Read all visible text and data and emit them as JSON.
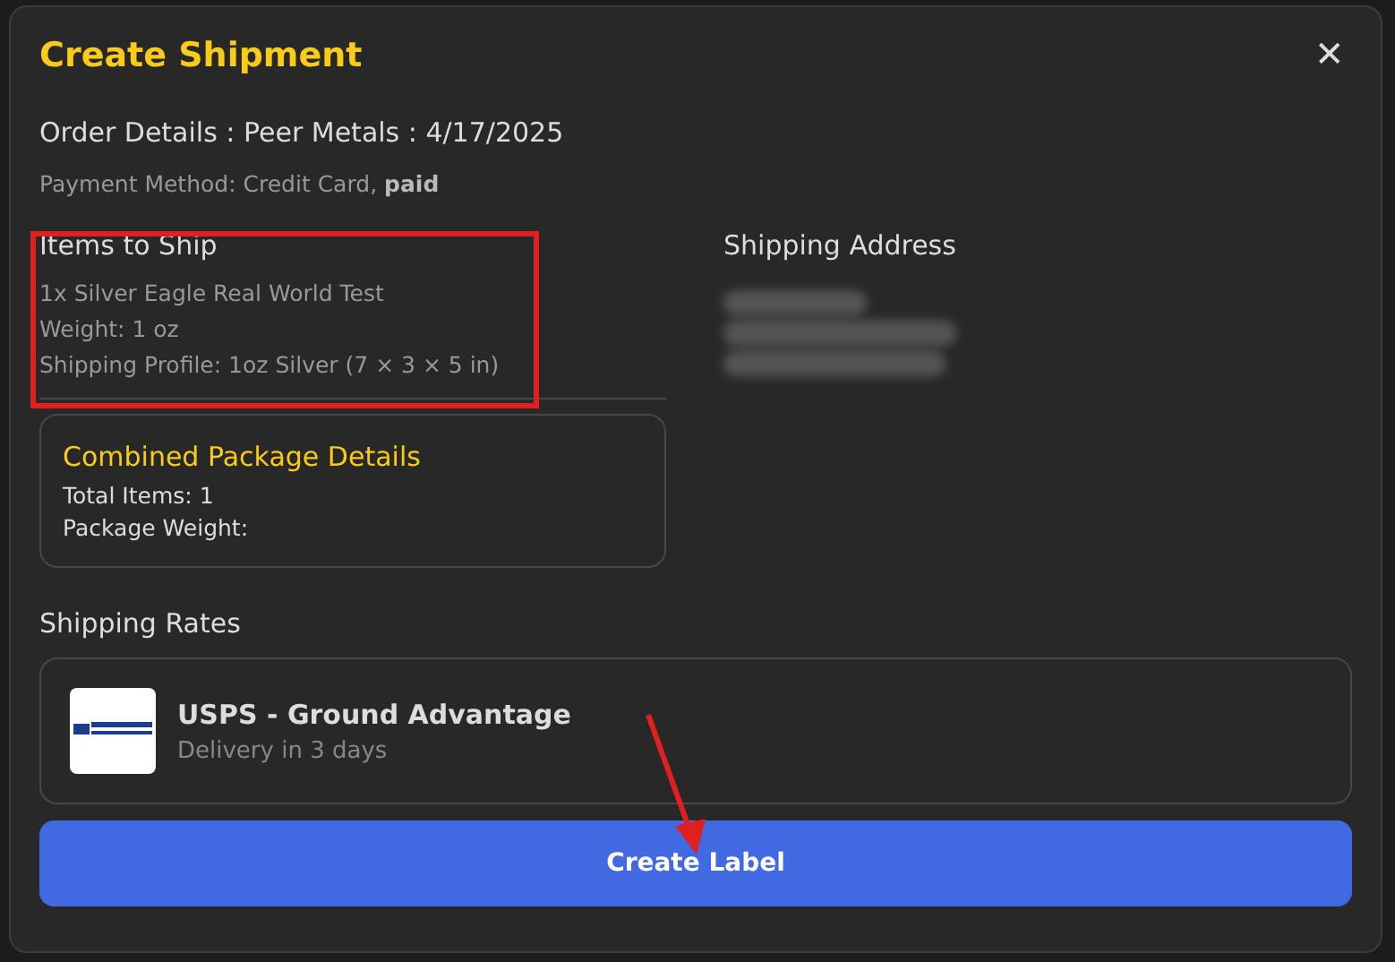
{
  "dialog": {
    "title": "Create Shipment",
    "close": "✕"
  },
  "order_details": "Order Details : Peer Metals : 4/17/2025",
  "payment": "Payment Method: Credit Card, **paid**",
  "items_to_ship": {
    "heading": "Items to Ship",
    "lines": [
      "1x Silver Eagle Real World Test",
      "Weight: 1 oz",
      "Shipping Profile: 1oz Silver (7 × 3 × 5 in)"
    ]
  },
  "shipping_address": {
    "heading": "Shipping Address"
  },
  "combined_package": {
    "heading": "Combined Package Details",
    "lines": [
      "Total Items: 1",
      "Package Weight:"
    ]
  },
  "shipping_rates": {
    "heading": "Shipping Rates",
    "rates": [
      {
        "carrier": "USPS - Ground Advantage",
        "delivery": "Delivery in 3 days"
      }
    ]
  },
  "button": "Create Label"
}
